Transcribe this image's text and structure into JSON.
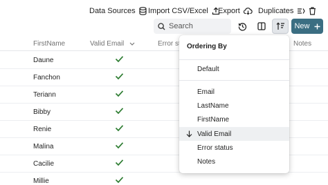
{
  "toolbar": {
    "data_sources": "Data Sources",
    "import": "Import CSV/Excel",
    "export": "Export",
    "duplicates": "Duplicates"
  },
  "search": {
    "placeholder": "Search"
  },
  "new_button": {
    "label": "New"
  },
  "table": {
    "columns": [
      "FirstName",
      "Valid Email",
      "Error sta",
      "Notes"
    ],
    "rows": [
      {
        "first_name": "Daune",
        "valid_email": true
      },
      {
        "first_name": "Fanchon",
        "valid_email": true
      },
      {
        "first_name": "Teriann",
        "valid_email": true
      },
      {
        "first_name": "Bibby",
        "valid_email": true
      },
      {
        "first_name": "Renie",
        "valid_email": true
      },
      {
        "first_name": "Malina",
        "valid_email": true
      },
      {
        "first_name": "Cacilie",
        "valid_email": true
      },
      {
        "first_name": "Millie",
        "valid_email": true
      }
    ]
  },
  "ordering_menu": {
    "title": "Ordering By",
    "default": "Default",
    "items": [
      "Email",
      "LastName",
      "FirstName",
      "Valid Email",
      "Error status",
      "Notes"
    ],
    "selected": "Valid Email",
    "direction": "descending"
  },
  "colors": {
    "accent": "#3b6e82",
    "check": "#2e7d32",
    "selected_row": "#eef0f2"
  }
}
